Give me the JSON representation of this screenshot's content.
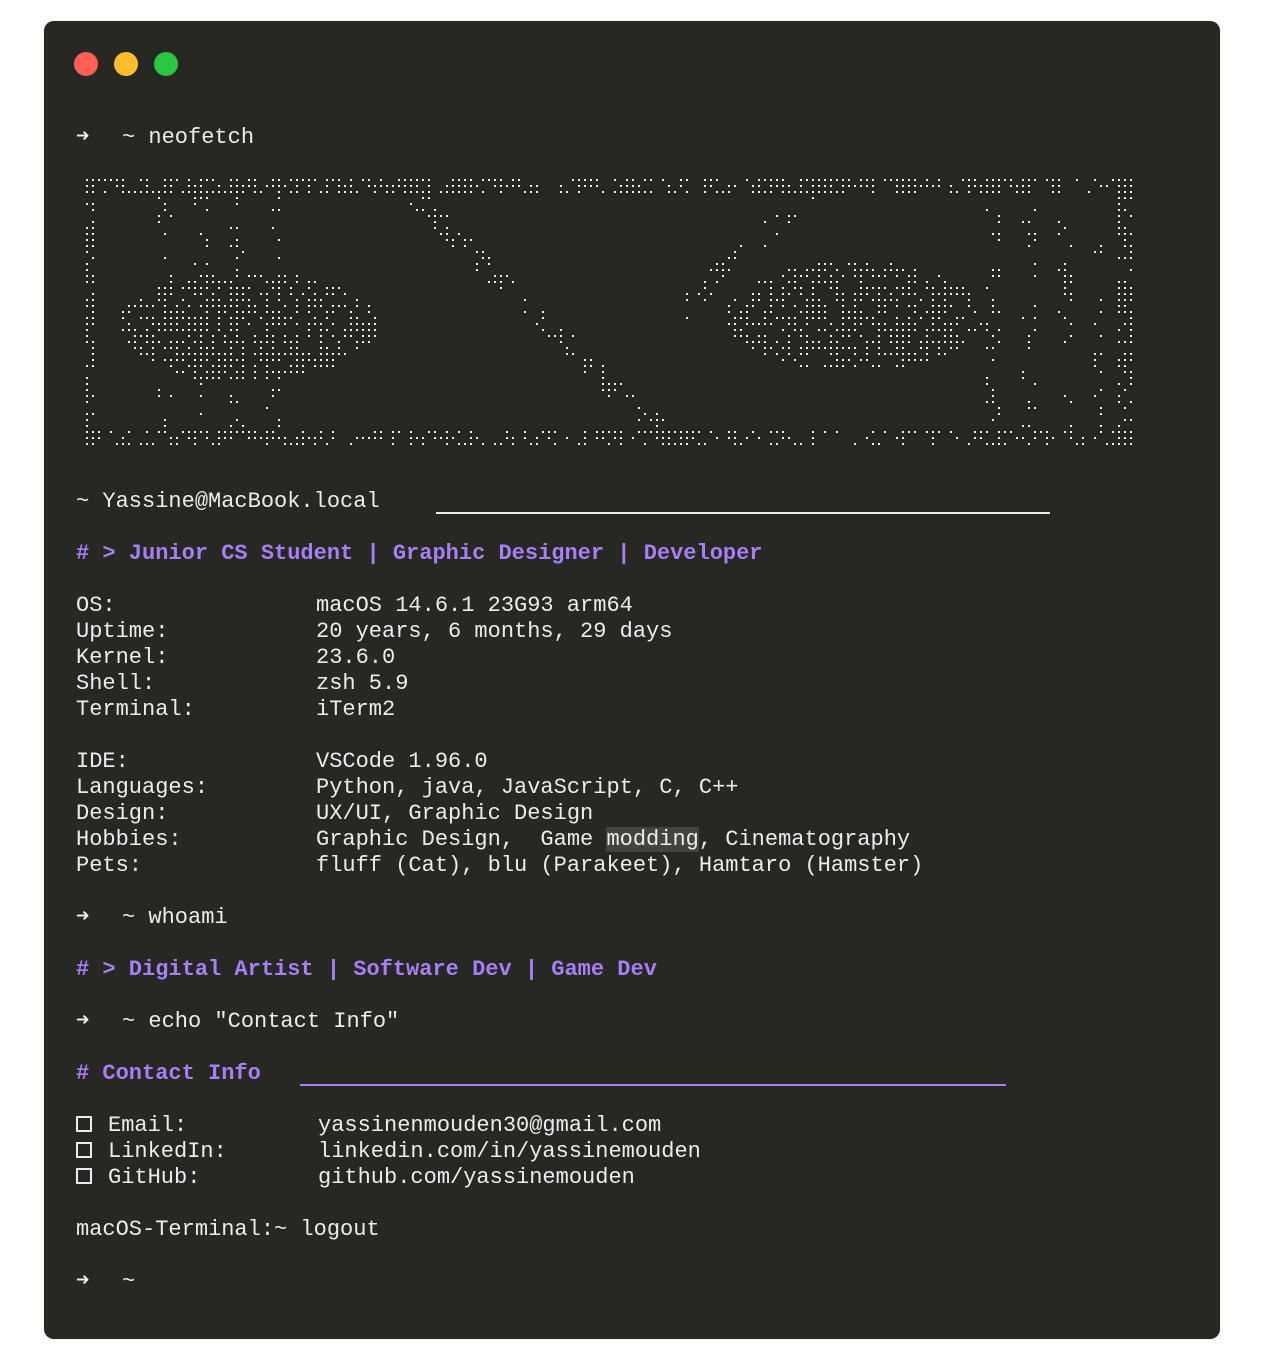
{
  "window": {
    "controls": [
      "close",
      "minimize",
      "zoom"
    ],
    "colors": {
      "background": "#272723",
      "text": "#ececec",
      "accent": "#a67ff5"
    }
  },
  "session": {
    "prompt_arrow": "➜",
    "prompt_dir": "~",
    "cmd1": "neofetch",
    "userhost": "~ Yassine@MacBook.local",
    "title_line": "# > Junior CS Student | Graphic Designer | Developer",
    "info_group1": [
      {
        "key": "OS:",
        "value": "macOS 14.6.1 23G93 arm64"
      },
      {
        "key": "Uptime:",
        "value": "20 years, 6 months, 29 days"
      },
      {
        "key": "Kernel:",
        "value": "23.6.0"
      },
      {
        "key": "Shell:",
        "value": "zsh 5.9"
      },
      {
        "key": "Terminal:",
        "value": "iTerm2"
      }
    ],
    "info_group2": [
      {
        "key": "IDE:",
        "value": "VSCode 1.96.0"
      },
      {
        "key": "Languages:",
        "value": "Python, java, JavaScript, C, C++"
      },
      {
        "key": "Design:",
        "value": "UX/UI, Graphic Design"
      },
      {
        "key": "Hobbies:",
        "value_pre": "Graphic Design,  Game ",
        "value_hl": "modding",
        "value_post": ", Cinematography"
      },
      {
        "key": "Pets:",
        "value": "fluff (Cat), blu (Parakeet), Hamtaro (Hamster)"
      }
    ],
    "cmd2": "whoami",
    "whoami_line": "# > Digital Artist | Software Dev | Game Dev",
    "cmd3": "echo \"Contact Info\"",
    "contact_header": "# Contact Info",
    "contacts": [
      {
        "key": "Email:",
        "value": "yassinenmouden30@gmail.com"
      },
      {
        "key": "LinkedIn:",
        "value": "linkedin.com/in/yassinemouden"
      },
      {
        "key": "GitHub:",
        "value": "github.com/yassinemouden"
      }
    ],
    "logout_line": "macOS-Terminal:~ logout"
  }
}
